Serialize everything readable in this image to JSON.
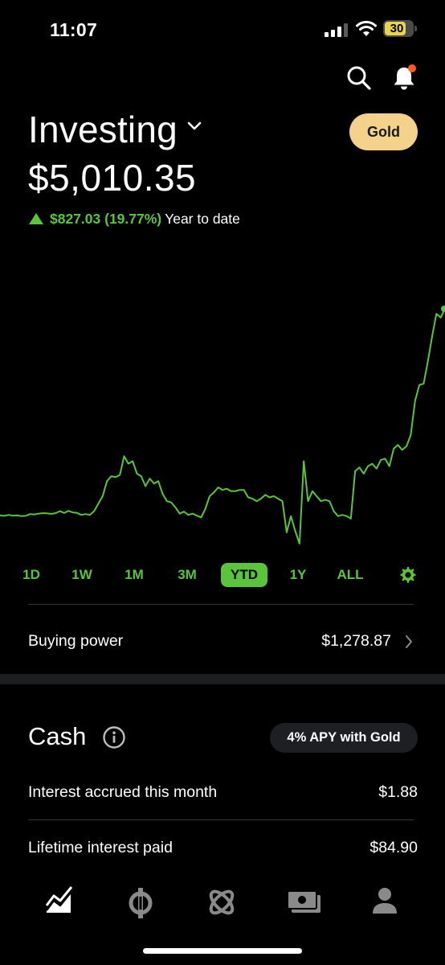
{
  "status_bar": {
    "time": "11:07",
    "battery": "30"
  },
  "header": {
    "title": "Investing",
    "gold_label": "Gold"
  },
  "portfolio": {
    "value": "$5,010.35",
    "change": "$827.03 (19.77%)",
    "period": "Year to date"
  },
  "colors": {
    "accent": "#5ac53b",
    "gold": "#f5d28b",
    "notification": "#ff5a1f"
  },
  "chart_data": {
    "type": "line",
    "x_index": [
      0,
      1,
      2,
      3,
      4,
      5,
      6,
      7,
      8,
      9,
      10,
      11,
      12,
      13,
      14,
      15,
      16,
      17,
      18,
      19,
      20,
      21,
      22,
      23,
      24,
      25,
      26,
      27,
      28,
      29,
      30,
      31,
      32,
      33,
      34,
      35,
      36,
      37,
      38,
      39,
      40,
      41,
      42,
      43,
      44,
      45,
      46,
      47,
      48,
      49,
      50,
      51,
      52,
      53,
      54,
      55,
      56,
      57,
      58,
      59,
      60,
      61,
      62,
      63,
      64,
      65,
      66,
      67,
      68,
      69,
      70,
      71,
      72,
      73,
      74,
      75,
      76,
      77,
      78,
      79,
      80,
      81,
      82,
      83,
      84,
      85,
      86,
      87,
      88,
      89,
      90,
      91,
      92,
      93,
      94,
      95,
      96,
      97,
      98,
      99,
      100,
      101,
      102,
      103,
      104,
      105,
      106,
      107,
      108,
      109,
      110,
      111,
      112,
      113,
      114,
      115,
      116,
      117,
      118,
      119
    ],
    "values": [
      4183,
      4181,
      4185,
      4182,
      4183,
      4180,
      4181,
      4188,
      4187,
      4190,
      4192,
      4191,
      4189,
      4192,
      4200,
      4193,
      4201,
      4195,
      4193,
      4185,
      4188,
      4185,
      4200,
      4230,
      4260,
      4320,
      4340,
      4336,
      4345,
      4420,
      4390,
      4400,
      4350,
      4340,
      4300,
      4330,
      4310,
      4320,
      4270,
      4240,
      4235,
      4215,
      4190,
      4198,
      4185,
      4190,
      4182,
      4175,
      4210,
      4260,
      4275,
      4295,
      4285,
      4290,
      4280,
      4280,
      4285,
      4285,
      4255,
      4250,
      4240,
      4250,
      4265,
      4255,
      4260,
      4250,
      4240,
      4115,
      4180,
      4120,
      4070,
      4400,
      4240,
      4280,
      4260,
      4240,
      4245,
      4240,
      4200,
      4180,
      4185,
      4180,
      4170,
      4360,
      4375,
      4350,
      4380,
      4390,
      4370,
      4405,
      4410,
      4380,
      4450,
      4465,
      4445,
      4460,
      4505,
      4640,
      4705,
      4710,
      4800,
      4900,
      4990,
      4975,
      5010
    ],
    "xlabel": "",
    "ylabel": ""
  },
  "ranges": [
    "1D",
    "1W",
    "1M",
    "3M",
    "YTD",
    "1Y",
    "ALL"
  ],
  "active_range": "YTD",
  "buying_power": {
    "label": "Buying power",
    "value": "$1,278.87"
  },
  "cash": {
    "title": "Cash",
    "apy_label": "4% APY with Gold",
    "rows": [
      {
        "label": "Interest accrued this month",
        "value": "$1.88"
      },
      {
        "label": "Lifetime interest paid",
        "value": "$84.90"
      }
    ]
  },
  "tabs": [
    {
      "icon": "chart-icon",
      "active": true
    },
    {
      "icon": "crypto-icon",
      "active": false
    },
    {
      "icon": "atom-icon",
      "active": false
    },
    {
      "icon": "cash-icon",
      "active": false
    },
    {
      "icon": "profile-icon",
      "active": false
    }
  ]
}
